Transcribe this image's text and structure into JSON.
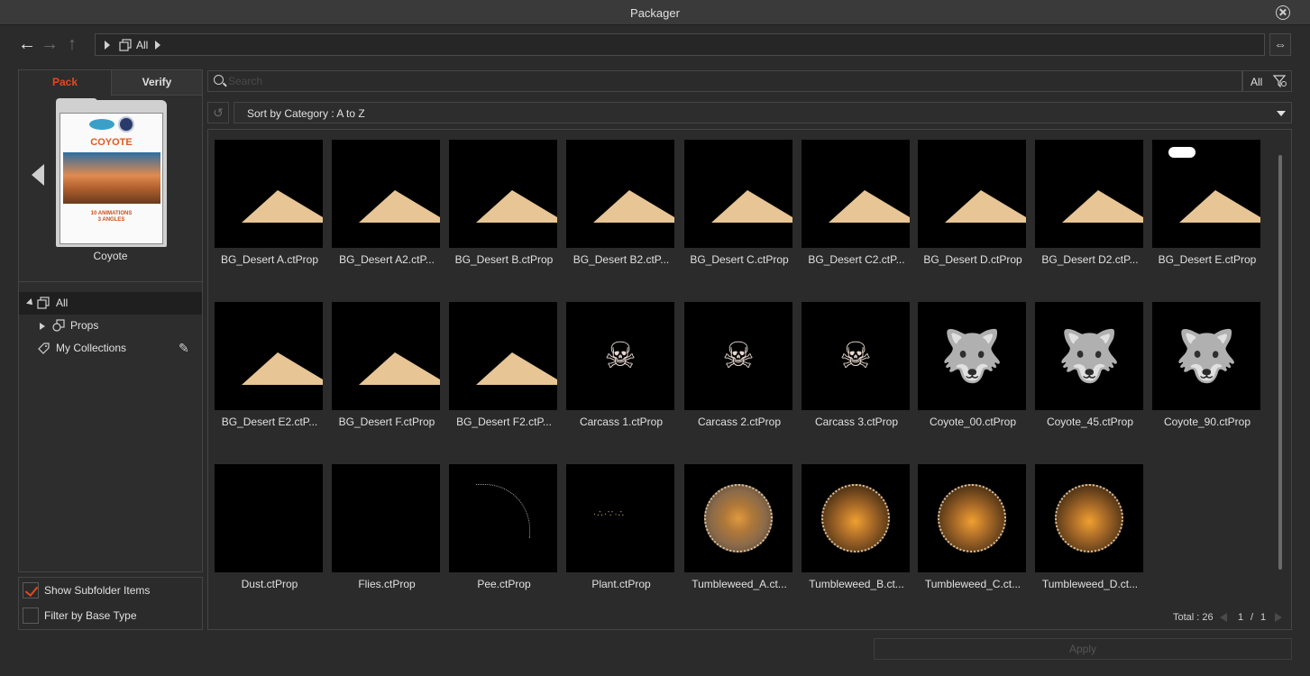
{
  "window": {
    "title": "Packager"
  },
  "nav": {
    "back_icon": "arrow-left-icon",
    "forward_icon": "arrow-right-icon",
    "up_icon": "arrow-up-icon"
  },
  "breadcrumb": {
    "label": "All"
  },
  "tabs": {
    "pack": "Pack",
    "verify": "Verify"
  },
  "package": {
    "name": "Coyote",
    "cover_title": "COYOTE",
    "cover_sub": "10 ANIMATIONS\n3 ANGLES"
  },
  "tree": {
    "all": "All",
    "props": "Props",
    "collections": "My Collections"
  },
  "options": {
    "show_subfolder": {
      "label": "Show Subfolder Items",
      "checked": true
    },
    "filter_base": {
      "label": "Filter by Base Type",
      "checked": false
    }
  },
  "search": {
    "placeholder": "Search",
    "filter_label": "All"
  },
  "sort": {
    "label": "Sort by Category : A to Z"
  },
  "items": [
    {
      "name": "BG_Desert A.ctProp",
      "kind": "desert-blue"
    },
    {
      "name": "BG_Desert A2.ctP...",
      "kind": "desert-black"
    },
    {
      "name": "BG_Desert B.ctProp",
      "kind": "desert-light"
    },
    {
      "name": "BG_Desert B2.ctP...",
      "kind": "desert-black"
    },
    {
      "name": "BG_Desert C.ctProp",
      "kind": "desert-blue"
    },
    {
      "name": "BG_Desert C2.ctP...",
      "kind": "desert-black"
    },
    {
      "name": "BG_Desert D.ctProp",
      "kind": "desert-blue"
    },
    {
      "name": "BG_Desert D2.ctP...",
      "kind": "desert-black"
    },
    {
      "name": "BG_Desert E.ctProp",
      "kind": "desert-cloud"
    },
    {
      "name": "BG_Desert E2.ctP...",
      "kind": "desert-black"
    },
    {
      "name": "BG_Desert F.ctProp",
      "kind": "desert-dusk"
    },
    {
      "name": "BG_Desert F2.ctP...",
      "kind": "desert-black2"
    },
    {
      "name": "Carcass 1.ctProp",
      "kind": "carcass"
    },
    {
      "name": "Carcass 2.ctProp",
      "kind": "carcass"
    },
    {
      "name": "Carcass 3.ctProp",
      "kind": "carcass"
    },
    {
      "name": "Coyote_00.ctProp",
      "kind": "coyote"
    },
    {
      "name": "Coyote_45.ctProp",
      "kind": "coyote"
    },
    {
      "name": "Coyote_90.ctProp",
      "kind": "coyote"
    },
    {
      "name": "Dust.ctProp",
      "kind": "dust"
    },
    {
      "name": "Flies.ctProp",
      "kind": "empty"
    },
    {
      "name": "Pee.ctProp",
      "kind": "pee"
    },
    {
      "name": "Plant.ctProp",
      "kind": "plant"
    },
    {
      "name": "Tumbleweed_A.ct...",
      "kind": "weed"
    },
    {
      "name": "Tumbleweed_B.ct...",
      "kind": "weed-dark"
    },
    {
      "name": "Tumbleweed_C.ct...",
      "kind": "weed-dark"
    },
    {
      "name": "Tumbleweed_D.ct...",
      "kind": "weed-dark"
    }
  ],
  "pagination": {
    "total": "Total : 26",
    "current": "1",
    "sep": "/",
    "pages": "1"
  },
  "apply": {
    "label": "Apply"
  },
  "colors": {
    "accent": "#e04a1f",
    "background": "#2b2b2b"
  }
}
